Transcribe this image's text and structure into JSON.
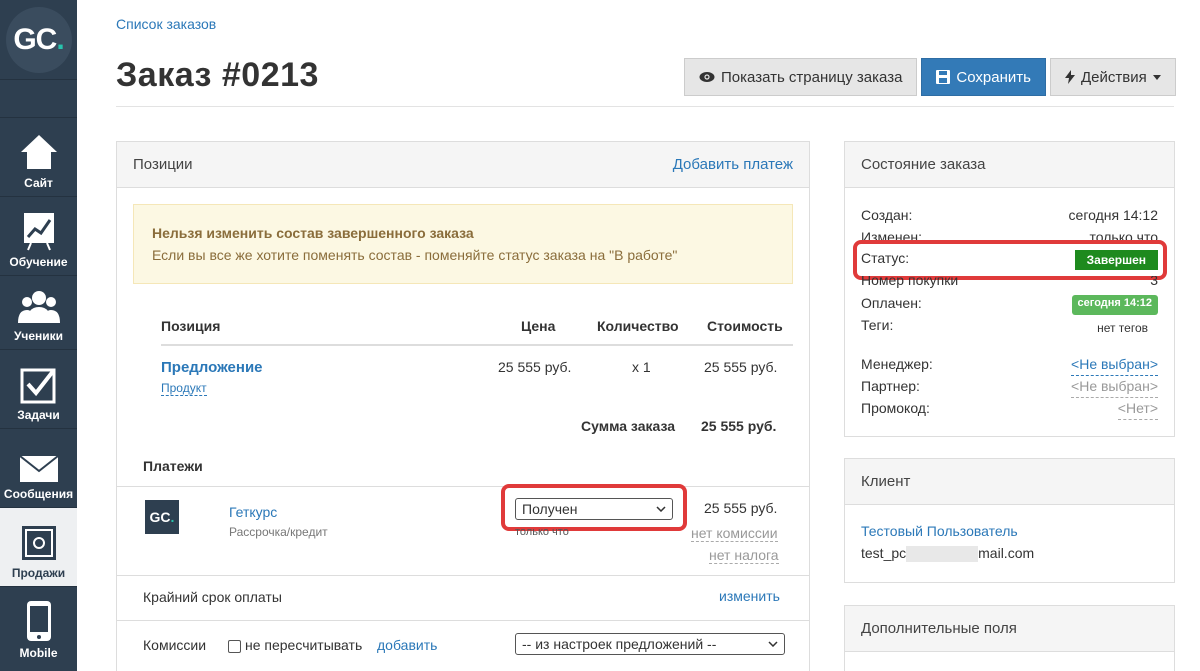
{
  "sidebar": {
    "logo_text": "GC",
    "logo_dot": ".",
    "items": [
      {
        "label": "Сайт",
        "icon": "home-icon"
      },
      {
        "label": "Обучение",
        "icon": "chart-board-icon"
      },
      {
        "label": "Ученики",
        "icon": "users-icon"
      },
      {
        "label": "Задачи",
        "icon": "checkbox-icon"
      },
      {
        "label": "Сообщения",
        "icon": "envelope-icon"
      },
      {
        "label": "Продажи",
        "icon": "safe-icon",
        "active": true
      },
      {
        "label": "Mobile",
        "icon": "phone-icon"
      }
    ]
  },
  "breadcrumb": "Список заказов",
  "page_title": "Заказ #0213",
  "toolbar": {
    "show_page": "Показать страницу заказа",
    "save": "Сохранить",
    "actions": "Действия"
  },
  "positions": {
    "header": "Позиции",
    "add_payment": "Добавить платеж",
    "alert_title": "Нельзя изменить состав завершенного заказа",
    "alert_text": "Если вы все же хотите поменять состав - поменяйте статус заказа на \"В работе\"",
    "columns": [
      "Позиция",
      "Цена",
      "Количество",
      "Стоимость"
    ],
    "row": {
      "name": "Предложение",
      "type": "Продукт",
      "price": "25 555 руб.",
      "qty": "x 1",
      "cost": "25 555 руб."
    },
    "total_label": "Сумма заказа",
    "total_value": "25 555 руб.",
    "payments_label": "Платежи",
    "payment": {
      "logo": "GC",
      "provider": "Геткурс",
      "method": "Рассрочка/кредит",
      "status": "Получен",
      "time": "только что",
      "amount": "25 555 руб.",
      "commission": "нет комиссии",
      "tax": "нет налога"
    },
    "deadline_label": "Крайний срок оплаты",
    "deadline_change": "изменить",
    "commissions_label": "Комиссии",
    "no_recalc": "не пересчитывать",
    "add": "добавить",
    "commission_select": "-- из настроек предложений --"
  },
  "order_state": {
    "header": "Состояние заказа",
    "created_label": "Создан:",
    "created_value": "сегодня 14:12",
    "changed_label": "Изменен:",
    "changed_value": "только что",
    "status_label": "Статус:",
    "status_value": "Завершен",
    "purchase_label": "Номер покупки",
    "purchase_value": "3",
    "paid_label": "Оплачен:",
    "paid_value": "сегодня 14:12",
    "tags_label": "Теги:",
    "tags_value": "нет тегов",
    "manager_label": "Менеджер:",
    "manager_value": "<Не выбран>",
    "partner_label": "Партнер:",
    "partner_value": "<Не выбран>",
    "promo_label": "Промокод:",
    "promo_value": "<Нет>"
  },
  "client": {
    "header": "Клиент",
    "name": "Тестовый Пользователь",
    "email_start": "test_pc",
    "email_end": "mail.com"
  },
  "extra": {
    "header": "Дополнительные поля"
  },
  "colors": {
    "sidebar": "#2e3f50",
    "link": "#2b78b8",
    "primary": "#337ab7",
    "status_done": "#1e8a1e",
    "highlight": "#e03a3a"
  }
}
